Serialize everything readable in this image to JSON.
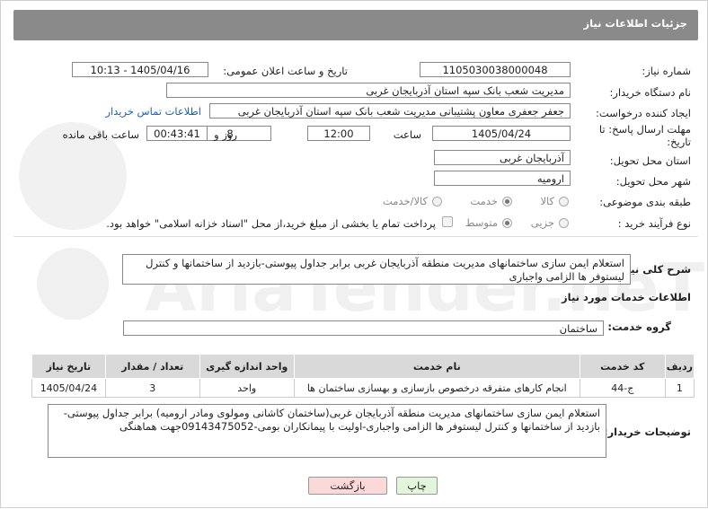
{
  "page_title": "جزئیات اطلاعات نیاز",
  "fields": {
    "need_number_label": "شماره نیاز:",
    "need_number": "1105030038000048",
    "announce_label": "تاریخ و ساعت اعلان عمومی:",
    "announce_value": "1405/04/16 - 10:13",
    "buyer_org_label": "نام دستگاه خریدار:",
    "buyer_org": "مدیریت شعب بانک سپه استان آذربایجان غربی",
    "creator_label": "ایجاد کننده درخواست:",
    "creator": "جعفر جعفری معاون پشتیبانی مدیریت شعب بانک سپه استان آذربایجان غربی",
    "contact_link": "اطلاعات تماس خریدار",
    "deadline_label_1": "مهلت ارسال پاسخ: تا",
    "deadline_label_2": "تاریخ:",
    "deadline_date": "1405/04/24",
    "time_label": "ساعت",
    "deadline_time": "12:00",
    "days_value": "8",
    "days_label": "روز و",
    "remaining_time": "00:43:41",
    "remaining_label": "ساعت باقی مانده",
    "province_label": "استان محل تحویل:",
    "province": "آذربایجان غربی",
    "city_label": "شهر محل تحویل:",
    "city": "ارومیه",
    "category_label": "طبقه بندی موضوعی:",
    "category_options": [
      "کالا",
      "خدمت",
      "کالا/خدمت"
    ],
    "category_selected": "خدمت",
    "process_label": "نوع فرآیند خرید :",
    "process_options": [
      "جزیی",
      "متوسط"
    ],
    "process_selected": "متوسط",
    "payment_note": "پرداخت تمام یا بخشی از مبلغ خرید،از محل \"اسناد خزانه اسلامی\" خواهد بود."
  },
  "general_desc": {
    "label": "شرح کلی نیاز:",
    "text": "استعلام ایمن سازی ساختمانهای مدیریت منطقه آذربایجان غربی برابر جداول پیوستی-بازدید از ساختمانها و کنترل لیستوفر ها الزامی واجباری"
  },
  "services": {
    "section_title": "اطلاعات خدمات مورد نیاز",
    "group_label": "گروه خدمت:",
    "group_value": "ساختمان",
    "columns": [
      "ردیف",
      "کد خدمت",
      "نام خدمت",
      "واحد اندازه گیری",
      "تعداد / مقدار",
      "تاریخ نیاز"
    ],
    "rows": [
      {
        "row": "1",
        "code": "ج-44",
        "name": "انجام کارهای متفرقه درخصوص بازسازی و بهسازی ساختمان ها",
        "unit": "واحد",
        "qty": "3",
        "date": "1405/04/24"
      }
    ]
  },
  "buyer_notes": {
    "label": "توضیحات خریدار:",
    "text": "استعلام ایمن سازی ساختمانهای مدیریت منطقه آذربایجان غربی(ساختمان کاشانی ومولوی ومادر ارومیه) برابر جداول پیوستی-بازدید از ساختمانها و کنترل لیستوفر ها الزامی واجباری-اولیت با پیمانکاران بومی-09143475052جهت هماهنگی"
  },
  "buttons": {
    "print": "چاپ",
    "back": "بازگشت"
  },
  "watermark": "AriaTender.neT",
  "colors": {
    "header_bg": "#8a8a8a",
    "link": "#1f5fb0",
    "print_btn_bg": "#e3f5da",
    "back_btn_bg": "#fbd9d9"
  }
}
